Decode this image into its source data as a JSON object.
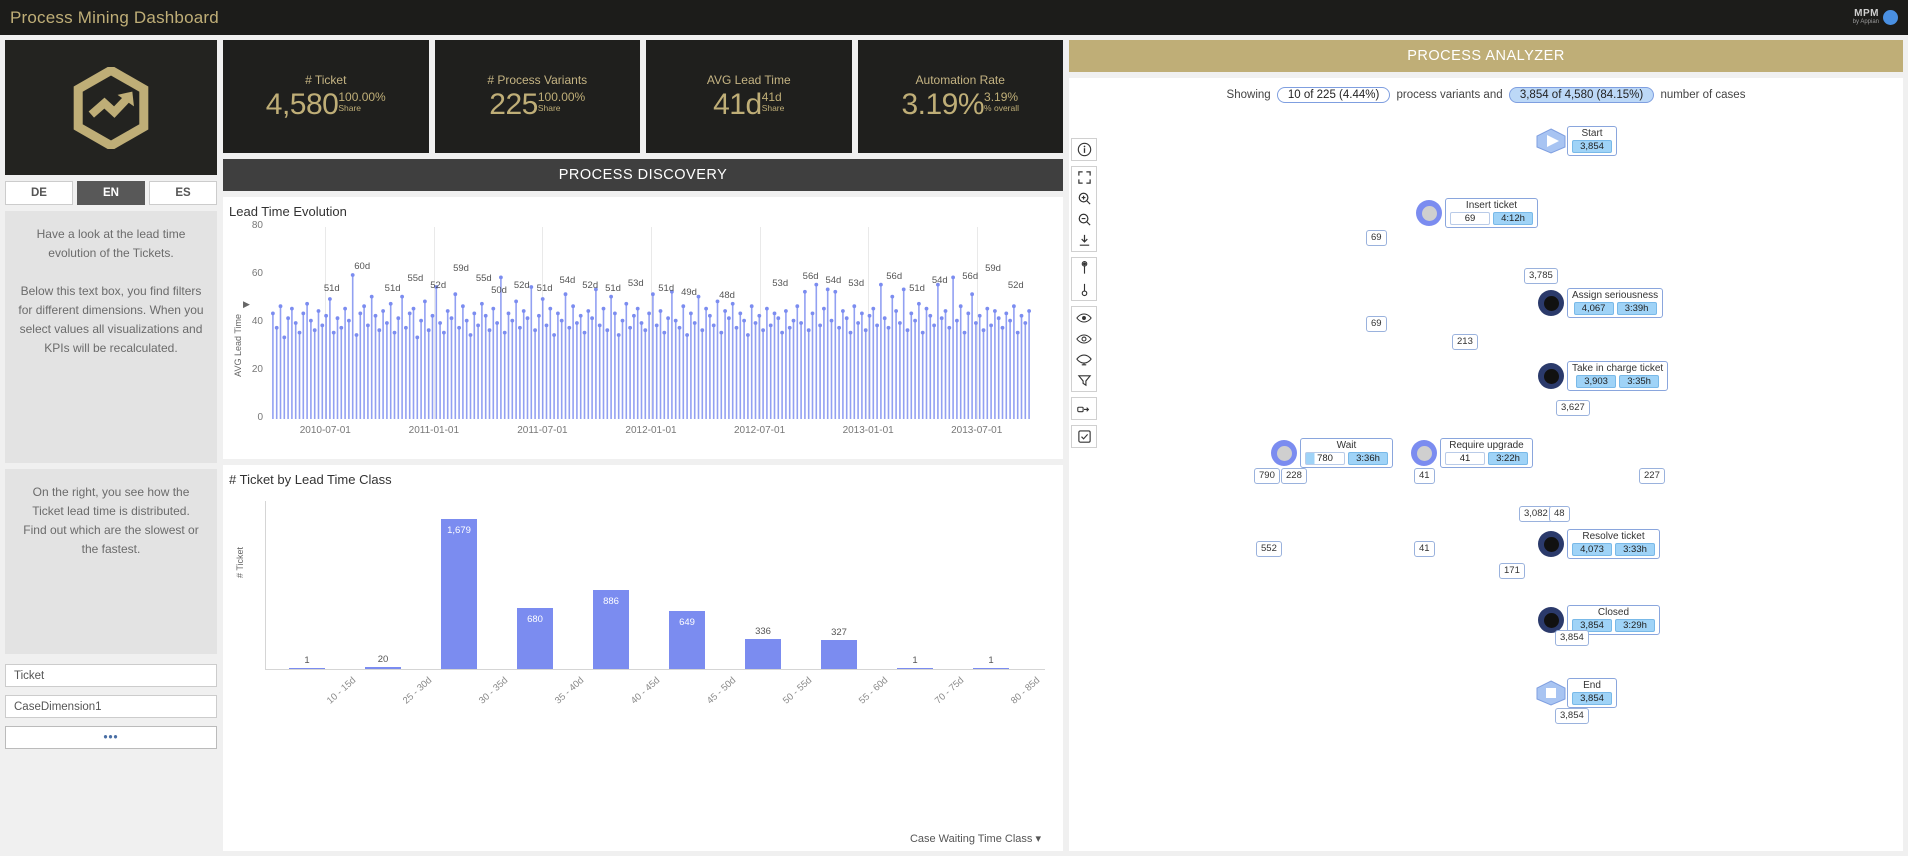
{
  "topbar": {
    "title": "Process Mining Dashboard",
    "brand_main": "MPM",
    "brand_sub": "by Appian"
  },
  "sidebar": {
    "logo_icon": "hexagon-trend-up-icon",
    "languages": [
      {
        "code": "DE",
        "active": false
      },
      {
        "code": "EN",
        "active": true
      },
      {
        "code": "ES",
        "active": false
      }
    ],
    "text_block_1": "Have a look at the lead time evolution of the Tickets.\n\nBelow this text box, you find filters for different dimensions. When you select values all visualizations and KPIs will be recalculated.",
    "text_block_2": "On the right, you see how the Ticket lead time is distributed.\nFind out which are the slowest or the fastest.",
    "filters": [
      {
        "label": "Ticket"
      },
      {
        "label": "CaseDimension1"
      }
    ],
    "more_label": "•••"
  },
  "kpis": [
    {
      "title": "# Ticket",
      "value": "4,580",
      "sub1": "100.00%",
      "sub2": "Share"
    },
    {
      "title": "# Process Variants",
      "value": "225",
      "sub1": "100.00%",
      "sub2": "Share"
    },
    {
      "title": "AVG Lead Time",
      "value": "41d",
      "sub1": "41d",
      "sub2": "Share"
    },
    {
      "title": "Automation Rate",
      "value": "3.19%",
      "sub1": "3.19%",
      "sub2": "% overall"
    }
  ],
  "process_discovery": {
    "header": "PROCESS DISCOVERY"
  },
  "process_analyzer": {
    "header": "PROCESS ANALYZER",
    "showing_prefix": "Showing",
    "variants_pill": "10 of 225 (4.44%)",
    "showing_mid": "process variants and",
    "cases_pill": "3,854 of 4,580 (84.15%)",
    "showing_suffix": "number of cases",
    "toolbar": [
      {
        "icon": "info-icon"
      },
      {
        "icon": "fit-screen-icon"
      },
      {
        "icon": "zoom-in-icon"
      },
      {
        "icon": "zoom-out-icon"
      },
      {
        "icon": "download-icon"
      },
      {
        "icon": "node-slider-icon"
      },
      {
        "icon": "edge-slider-icon"
      },
      {
        "icon": "eye-frequency-icon"
      },
      {
        "icon": "eye-duration-icon"
      },
      {
        "icon": "eye-toggle-icon"
      },
      {
        "icon": "filter-funnel-icon"
      },
      {
        "icon": "animate-icon"
      },
      {
        "icon": "checkbox-icon"
      }
    ],
    "nodes": [
      {
        "id": "start",
        "name": "Start",
        "count": "3,854",
        "duration": "",
        "type": "start"
      },
      {
        "id": "insert",
        "name": "Insert ticket",
        "count": "69",
        "duration": "4:12h",
        "type": "activity-light"
      },
      {
        "id": "assign",
        "name": "Assign seriousness",
        "count": "4,067",
        "duration": "3:39h",
        "type": "activity-dark"
      },
      {
        "id": "takecharge",
        "name": "Take in charge ticket",
        "count": "3,903",
        "duration": "3:35h",
        "type": "activity-dark"
      },
      {
        "id": "wait",
        "name": "Wait",
        "count": "780",
        "duration": "3:36h",
        "type": "activity-light"
      },
      {
        "id": "upgrade",
        "name": "Require upgrade",
        "count": "41",
        "duration": "3:22h",
        "type": "activity-light"
      },
      {
        "id": "resolve",
        "name": "Resolve ticket",
        "count": "4,073",
        "duration": "3:33h",
        "type": "activity-dark"
      },
      {
        "id": "closed",
        "name": "Closed",
        "count": "3,854",
        "duration": "3:29h",
        "type": "activity-dark"
      },
      {
        "id": "end",
        "name": "End",
        "count": "3,854",
        "duration": "",
        "type": "end"
      }
    ],
    "edges": [
      {
        "label": "69"
      },
      {
        "label": "3,785"
      },
      {
        "label": "69"
      },
      {
        "label": "213"
      },
      {
        "label": "3,627"
      },
      {
        "label": "790"
      },
      {
        "label": "228"
      },
      {
        "label": "41"
      },
      {
        "label": "227"
      },
      {
        "label": "3,082"
      },
      {
        "label": "48"
      },
      {
        "label": "552"
      },
      {
        "label": "41"
      },
      {
        "label": "171"
      },
      {
        "label": "3,854"
      },
      {
        "label": "3,854"
      }
    ]
  },
  "chart_data": [
    {
      "type": "line",
      "title": "Lead Time Evolution",
      "xlabel": "",
      "ylabel": "AVG Lead Time",
      "ylim": [
        0,
        80
      ],
      "yticks": [
        0,
        20,
        40,
        60,
        80
      ],
      "xticks": [
        "2010-07-01",
        "2011-01-01",
        "2011-07-01",
        "2012-01-01",
        "2012-07-01",
        "2013-01-01",
        "2013-07-01"
      ],
      "grid": true,
      "series_color": "#7b8cf0",
      "annotations": [
        {
          "x_pct": 8,
          "label": "51d"
        },
        {
          "x_pct": 12,
          "label": "60d"
        },
        {
          "x_pct": 16,
          "label": "51d"
        },
        {
          "x_pct": 19,
          "label": "55d"
        },
        {
          "x_pct": 22,
          "label": "52d"
        },
        {
          "x_pct": 25,
          "label": "59d"
        },
        {
          "x_pct": 28,
          "label": "55d"
        },
        {
          "x_pct": 30,
          "label": "50d"
        },
        {
          "x_pct": 33,
          "label": "52d"
        },
        {
          "x_pct": 36,
          "label": "51d"
        },
        {
          "x_pct": 39,
          "label": "54d"
        },
        {
          "x_pct": 42,
          "label": "52d"
        },
        {
          "x_pct": 45,
          "label": "51d"
        },
        {
          "x_pct": 48,
          "label": "53d"
        },
        {
          "x_pct": 52,
          "label": "51d"
        },
        {
          "x_pct": 55,
          "label": "49d"
        },
        {
          "x_pct": 60,
          "label": "48d"
        },
        {
          "x_pct": 67,
          "label": "53d"
        },
        {
          "x_pct": 71,
          "label": "56d"
        },
        {
          "x_pct": 74,
          "label": "54d"
        },
        {
          "x_pct": 77,
          "label": "53d"
        },
        {
          "x_pct": 82,
          "label": "56d"
        },
        {
          "x_pct": 85,
          "label": "51d"
        },
        {
          "x_pct": 88,
          "label": "54d"
        },
        {
          "x_pct": 92,
          "label": "56d"
        },
        {
          "x_pct": 95,
          "label": "59d"
        },
        {
          "x_pct": 98,
          "label": "52d"
        }
      ],
      "values": [
        44,
        38,
        47,
        34,
        42,
        46,
        40,
        36,
        44,
        48,
        41,
        37,
        45,
        39,
        43,
        50,
        36,
        42,
        38,
        46,
        41,
        60,
        35,
        44,
        47,
        39,
        51,
        43,
        37,
        45,
        40,
        48,
        36,
        42,
        51,
        38,
        44,
        46,
        34,
        41,
        49,
        37,
        43,
        55,
        40,
        36,
        45,
        42,
        52,
        38,
        47,
        41,
        35,
        44,
        39,
        48,
        43,
        37,
        46,
        40,
        59,
        36,
        44,
        41,
        49,
        38,
        45,
        42,
        55,
        37,
        43,
        50,
        39,
        46,
        35,
        44,
        41,
        52,
        38,
        47,
        40,
        43,
        36,
        45,
        42,
        54,
        39,
        46,
        37,
        51,
        44,
        35,
        41,
        48,
        38,
        43,
        46,
        40,
        37,
        44,
        52,
        39,
        45,
        36,
        42,
        53,
        41,
        38,
        47,
        35,
        44,
        40,
        51,
        37,
        46,
        43,
        39,
        49,
        36,
        45,
        42,
        48,
        38,
        44,
        41,
        35,
        47,
        40,
        43,
        37,
        46,
        39,
        44,
        42,
        36,
        45,
        38,
        41,
        47,
        40,
        53,
        37,
        44,
        56,
        39,
        46,
        54,
        41,
        53,
        38,
        45,
        42,
        36,
        47,
        40,
        44,
        37,
        43,
        46,
        39,
        56,
        42,
        38,
        51,
        45,
        40,
        54,
        37,
        44,
        41,
        48,
        36,
        46,
        43,
        39,
        56,
        42,
        45,
        38,
        59,
        41,
        47,
        36,
        44,
        52,
        40,
        43,
        37,
        46,
        39,
        45,
        42,
        38,
        44,
        41,
        47,
        36,
        43,
        40,
        45
      ]
    },
    {
      "type": "bar",
      "title": "# Ticket by Lead Time Class",
      "xlabel": "Case Waiting Time Class",
      "ylabel": "# Ticket",
      "categories": [
        "10 - 15d",
        "25 - 30d",
        "30 - 35d",
        "35 - 40d",
        "40 - 45d",
        "45 - 50d",
        "50 - 55d",
        "55 - 60d",
        "70 - 75d",
        "80 - 85d"
      ],
      "values": [
        1,
        20,
        1679,
        680,
        886,
        649,
        336,
        327,
        1,
        1
      ],
      "value_labels": [
        "1",
        "20",
        "1,679",
        "680",
        "886",
        "649",
        "336",
        "327",
        "1",
        "1"
      ],
      "ylim": [
        0,
        1679
      ],
      "bar_color": "#7b8cf0",
      "grid": false
    }
  ]
}
